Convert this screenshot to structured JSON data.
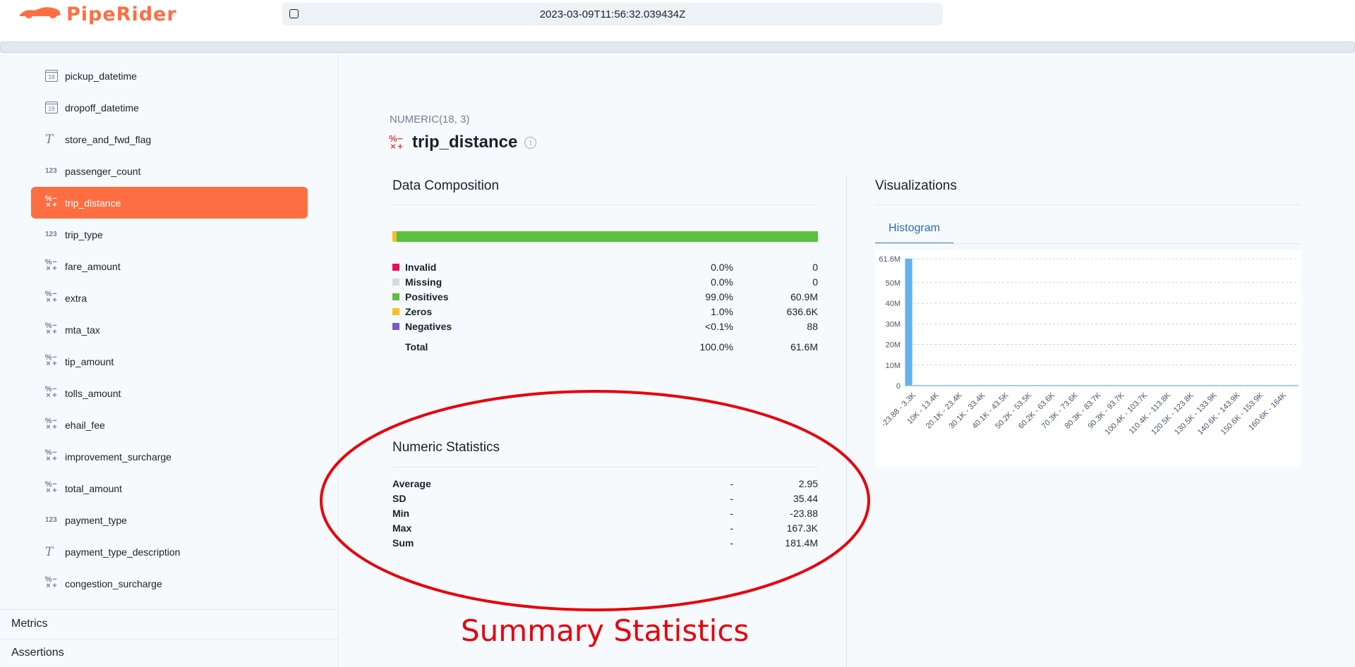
{
  "header": {
    "logo_text": "PipeRider",
    "run_timestamp": "2023-03-09T11:56:32.039434Z"
  },
  "sidebar": {
    "columns": [
      {
        "name": "pickup_datetime",
        "icon": "calendar-icon"
      },
      {
        "name": "dropoff_datetime",
        "icon": "calendar-icon"
      },
      {
        "name": "store_and_fwd_flag",
        "icon": "text-icon"
      },
      {
        "name": "passenger_count",
        "icon": "integer-icon"
      },
      {
        "name": "trip_distance",
        "icon": "numeric-icon",
        "active": true
      },
      {
        "name": "trip_type",
        "icon": "integer-icon"
      },
      {
        "name": "fare_amount",
        "icon": "numeric-icon"
      },
      {
        "name": "extra",
        "icon": "numeric-icon"
      },
      {
        "name": "mta_tax",
        "icon": "numeric-icon"
      },
      {
        "name": "tip_amount",
        "icon": "numeric-icon"
      },
      {
        "name": "tolls_amount",
        "icon": "numeric-icon"
      },
      {
        "name": "ehail_fee",
        "icon": "numeric-icon"
      },
      {
        "name": "improvement_surcharge",
        "icon": "numeric-icon"
      },
      {
        "name": "total_amount",
        "icon": "numeric-icon"
      },
      {
        "name": "payment_type",
        "icon": "integer-icon"
      },
      {
        "name": "payment_type_description",
        "icon": "text-icon"
      },
      {
        "name": "congestion_surcharge",
        "icon": "numeric-icon"
      }
    ],
    "icon_glyphs": {
      "calendar": "19",
      "text": "T",
      "integer": "123",
      "numeric": [
        "%",
        "−",
        "×",
        "+"
      ]
    },
    "sections": {
      "metrics": "Metrics",
      "assertions": "Assertions"
    }
  },
  "column": {
    "type": "NUMERIC(18, 3)",
    "name": "trip_distance",
    "info_glyph": "i"
  },
  "composition": {
    "title": "Data Composition",
    "bar": {
      "zeros_fraction": 0.01,
      "positives_fraction": 0.99
    },
    "rows": [
      {
        "label": "Invalid",
        "pct": "0.0%",
        "count": "0",
        "color": "#ed0b5a"
      },
      {
        "label": "Missing",
        "pct": "0.0%",
        "count": "0",
        "color": "#d9d9d9"
      },
      {
        "label": "Positives",
        "pct": "99.0%",
        "count": "60.9M",
        "color": "#5bbf3f"
      },
      {
        "label": "Zeros",
        "pct": "1.0%",
        "count": "636.6K",
        "color": "#f6c026"
      },
      {
        "label": "Negatives",
        "pct": "<0.1%",
        "count": "88",
        "color": "#7e57c2"
      }
    ],
    "total": {
      "label": "Total",
      "pct": "100.0%",
      "count": "61.6M"
    }
  },
  "numeric_stats": {
    "title": "Numeric Statistics",
    "rows": [
      {
        "label": "Average",
        "dash": "-",
        "value": "2.95"
      },
      {
        "label": "SD",
        "dash": "-",
        "value": "35.44"
      },
      {
        "label": "Min",
        "dash": "-",
        "value": "-23.88"
      },
      {
        "label": "Max",
        "dash": "-",
        "value": "167.3K"
      },
      {
        "label": "Sum",
        "dash": "-",
        "value": "181.4M"
      }
    ]
  },
  "visualizations": {
    "title": "Visualizations",
    "tab": "Histogram"
  },
  "chart_data": {
    "type": "bar",
    "categories": [
      "-23.88 - 3.3K",
      "10K - 13.4K",
      "20.1K - 23.4K",
      "30.1K - 33.4K",
      "40.1K - 43.5K",
      "50.2K - 53.5K",
      "60.2K - 63.6K",
      "70.3K - 73.6K",
      "80.3K - 83.7K",
      "90.3K - 93.7K",
      "100.4K - 103.7K",
      "110.4K - 113.8K",
      "120.5K - 123.8K",
      "130.5K - 133.9K",
      "140.6K - 143.9K",
      "150.6K - 153.9K",
      "160.6K - 164K"
    ],
    "values": [
      61600000,
      0,
      0,
      0,
      0,
      0,
      0,
      0,
      0,
      0,
      0,
      0,
      0,
      0,
      0,
      0,
      0
    ],
    "yticks": [
      "0",
      "10M",
      "20M",
      "30M",
      "40M",
      "50M",
      "61.6M"
    ],
    "ytick_values": [
      0,
      10000000,
      20000000,
      30000000,
      40000000,
      50000000,
      61600000
    ],
    "ylim": [
      0,
      61600000
    ],
    "bar_color": "#63b3ed",
    "grid": true
  },
  "annotation": {
    "text": "Summary Statistics",
    "color": "#e8000b"
  }
}
